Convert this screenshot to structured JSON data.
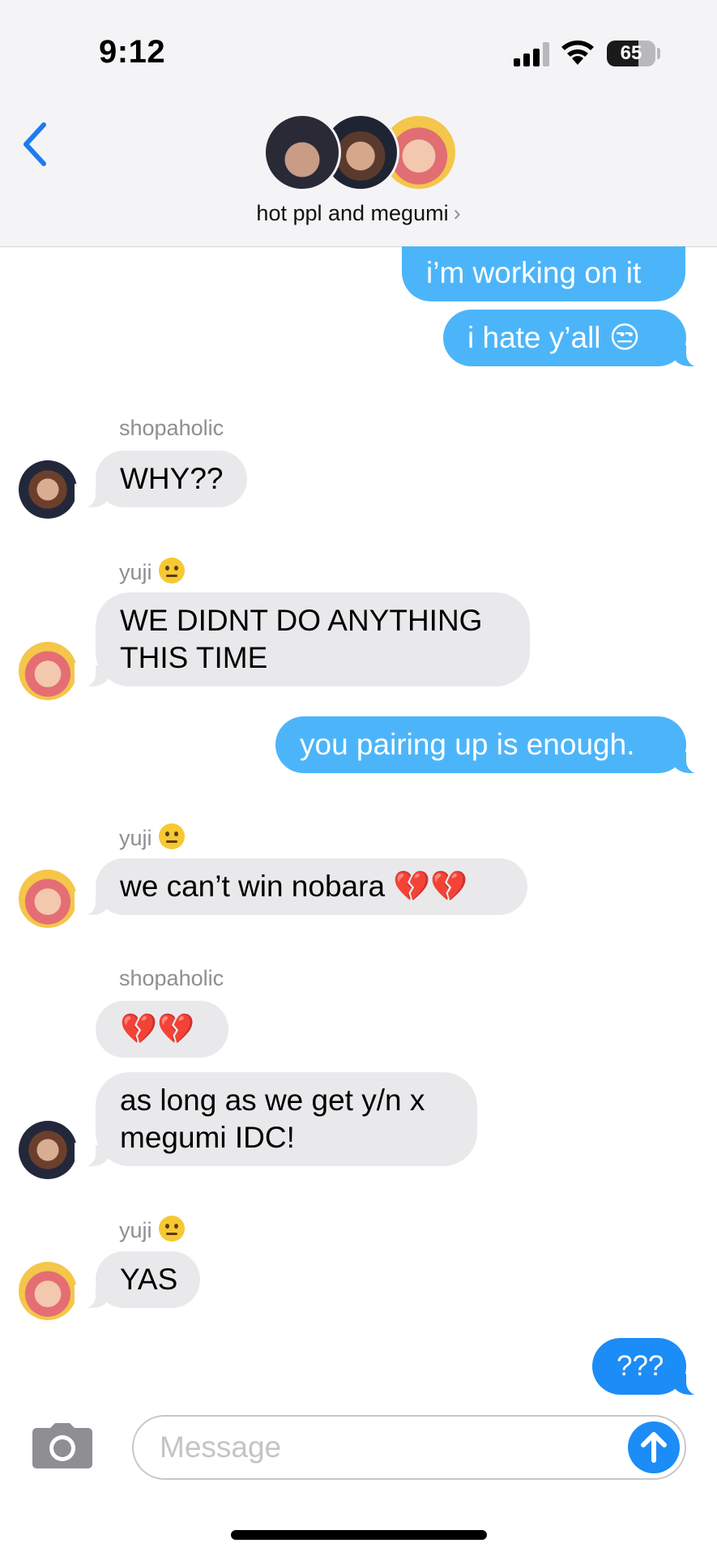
{
  "status_bar": {
    "time": "9:12",
    "battery_percent": "65",
    "battery_level": 0.65
  },
  "header": {
    "back_icon": "chevron-left-icon",
    "group_name": "hot ppl and megumi",
    "chevron": "›"
  },
  "messages": [
    {
      "side": "out",
      "text": "i’m working on it"
    },
    {
      "side": "out",
      "text": "i hate y’all 😒"
    },
    {
      "side": "in",
      "sender": "shopaholic",
      "text": "WHY??"
    },
    {
      "side": "in",
      "sender": "yuji",
      "text_lines": [
        "WE DIDNT DO ANYTHING",
        "THIS TIME"
      ]
    },
    {
      "side": "out",
      "text": "you pairing up is enough."
    },
    {
      "side": "in",
      "sender": "yuji",
      "text": "we can’t win nobara 💔💔"
    },
    {
      "side": "in",
      "sender": "shopaholic",
      "text": "💔💔"
    },
    {
      "side": "in",
      "sender": "shopaholic",
      "text_lines": [
        "as long as we get y/n x",
        "megumi IDC!"
      ]
    },
    {
      "side": "in",
      "sender": "yuji",
      "text": "YAS"
    },
    {
      "side": "out",
      "text": "???"
    }
  ],
  "composer": {
    "placeholder": "Message",
    "camera_icon": "camera-icon",
    "send_icon": "arrow-up-icon"
  },
  "colors": {
    "outgoing": "#4cb5f9",
    "outgoing_latest": "#1c8cf6",
    "incoming": "#e9e9eb",
    "accent": "#1c8cf6"
  }
}
